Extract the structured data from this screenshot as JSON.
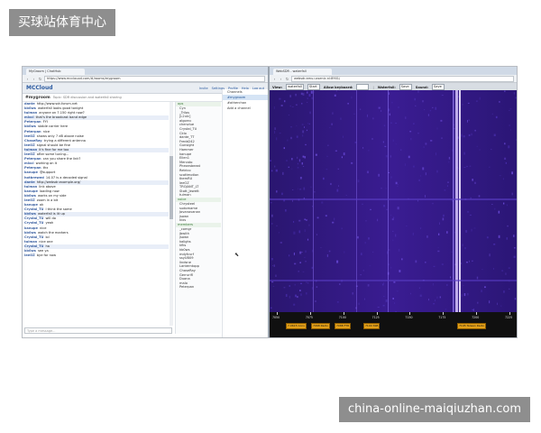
{
  "watermarks": {
    "top": "买球站体育中心",
    "bottom": "china-online-maiqiuzhan.com"
  },
  "left_window": {
    "tab": "MyGroom | ChatHub",
    "url": "https://www.mcclouod.com/#/rooms/mygroom",
    "app_logo": "MCCloud",
    "header_links": [
      "Invite",
      "Settings",
      "Profile",
      "Help",
      "Log out"
    ],
    "room_name": "#mygroom",
    "room_topic": "Topic: SDR discussion and waterfall sharing",
    "room_buttons": [
      "Leave",
      "Options"
    ],
    "messages": [
      {
        "nick": "dante",
        "text": "http://www.sdr-forum.net"
      },
      {
        "nick": "kb0ws",
        "text": "waterfall looks good tonight"
      },
      {
        "nick": "tulman",
        "text": "anyone on 7.150 right now?"
      },
      {
        "nick": "mixcl",
        "text": "that's the broadcast band edge"
      },
      {
        "nick": "Peterpan",
        "text": "FYI"
      },
      {
        "nick": "kb0ws",
        "text": "stable carrier here"
      },
      {
        "nick": "Peterpan",
        "text": "nice"
      },
      {
        "nick": "leeOZ",
        "text": "shows only 7 dB above noise"
      },
      {
        "nick": "ChaseRay",
        "text": "trying a different antenna"
      },
      {
        "nick": "leeOZ",
        "text": "signal should be fine"
      },
      {
        "nick": "tulman",
        "text": "it's fine for me too"
      },
      {
        "nick": "leeOZ",
        "text": "after some tuning..."
      },
      {
        "nick": "Peterpan",
        "text": "can you share the link?"
      },
      {
        "nick": "mixcl",
        "text": "working on it"
      },
      {
        "nick": "Peterpan",
        "text": "thx"
      },
      {
        "nick": "kanupe",
        "text": "@support"
      },
      {
        "nick": "hotbrewed",
        "text": "14.07 is a decoded signal"
      },
      {
        "nick": "dante",
        "text": "http://websdr.example.org/"
      },
      {
        "nick": "tulman",
        "text": "link above"
      },
      {
        "nick": "kanupe",
        "text": "loading now"
      },
      {
        "nick": "kb0ws",
        "text": "works on my side"
      },
      {
        "nick": "leeOZ",
        "text": "zoom in a bit"
      },
      {
        "nick": "kanupe",
        "text": "ok"
      },
      {
        "nick": "Crystal_TU",
        "text": "I think the same"
      },
      {
        "nick": "kb0ws",
        "text": "waterfall is lit up"
      },
      {
        "nick": "Crystal_TU",
        "text": "will do"
      },
      {
        "nick": "Crystal_TU",
        "text": "yeah"
      },
      {
        "nick": "kanupe",
        "text": "nice"
      },
      {
        "nick": "kb0ws",
        "text": "watch the markers"
      },
      {
        "nick": "Crystal_TU",
        "text": "lol"
      },
      {
        "nick": "tulman",
        "text": "nice one"
      },
      {
        "nick": "Crystal_TU",
        "text": "ha"
      },
      {
        "nick": "kb0ws",
        "text": "see ya"
      },
      {
        "nick": "leeOZ",
        "text": "bye for now"
      }
    ],
    "input_placeholder": "Type a message...",
    "user_groups": [
      {
        "name": "ops",
        "users": [
          "Cyn",
          "_Trilos",
          "[L2ulc]",
          "algornc",
          "chenzlue",
          "Crystal_TU",
          "Cklo",
          "dante_TT",
          "Fredd242",
          "Gunsight",
          "Hammer",
          "kanupe",
          "Ellen1",
          "Mercato",
          "Pheonsbeast",
          "Retrico",
          "scottmotion",
          "tkemRU",
          "leeOZ",
          "TROJANT_LT",
          "Stott_Jewett",
          "tulman"
        ]
      },
      {
        "name": "voice",
        "users": [
          "Chrysteel",
          "sudomame",
          "Jovanovanan",
          "jsown",
          "kixs"
        ]
      },
      {
        "name": "members",
        "users": [
          "_comgr",
          "jbwith",
          "jsown",
          "kalighs",
          "kfks",
          "kb0ws",
          "mdyfcvrf",
          "ssyUB09",
          "lindsne",
          "Lanterntopp",
          "ChaseRay",
          "Gerrurifl",
          "Duana",
          "malo",
          "Peterpan"
        ]
      }
    ],
    "side_items": [
      "Channels",
      "#mygroom",
      "#otherchan",
      "Add a channel"
    ]
  },
  "right_window": {
    "tab": "WebSDR - waterfall",
    "url": "websdr.amu.ucsenic.nl:8901/",
    "toolbar": {
      "view_label": "View:",
      "view_value": "waterfall",
      "start_label": "Start",
      "allow_label": "Allow keyboard:",
      "waterfall_label": "Waterfall:",
      "waterfall_value": "Save",
      "sound_label": "Sound:",
      "sound_value": "Save"
    },
    "freq_labels": [
      "7050",
      "7075",
      "7100",
      "7125",
      "7150",
      "7175",
      "7200",
      "7225"
    ],
    "markers": [
      "7.0615 Conv",
      "7068 Radio",
      "7088 FT8",
      "7104 SSB",
      "7195 Taiwan Radio"
    ]
  }
}
